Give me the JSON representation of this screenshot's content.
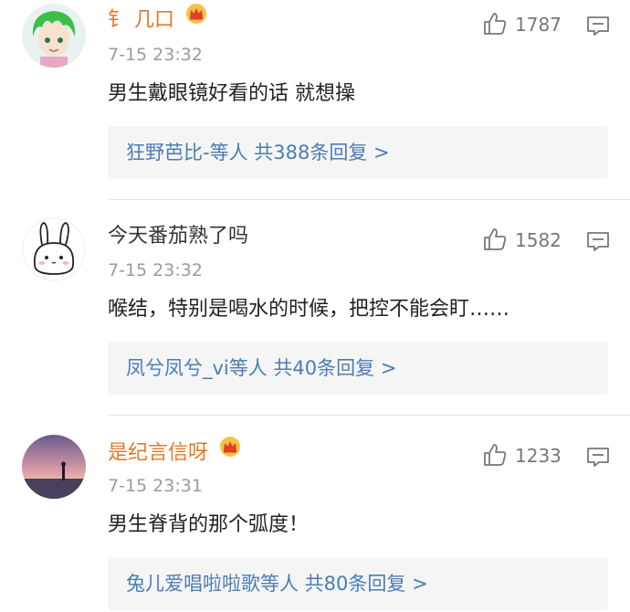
{
  "comments": [
    {
      "username": "钅 几口",
      "time": "7-15 23:32",
      "text": "男生戴眼镜好看的话 就想操",
      "likes": "1787",
      "replies": "狂野芭比-等人 共388条回复 >",
      "vip": true
    },
    {
      "username": "今天番茄熟了吗",
      "time": "7-15 23:32",
      "text": "喉结，特别是喝水的时候，把控不能会盯……",
      "likes": "1582",
      "replies": "凤兮凤兮_vi等人 共40条回复 >",
      "vip": false
    },
    {
      "username": "是纪言信呀",
      "time": "7-15 23:31",
      "text": "男生脊背的那个弧度！",
      "likes": "1233",
      "replies": "兔儿爱唱啦啦歌等人 共80条回复 >",
      "vip": true
    }
  ],
  "colors": {
    "vip_name": "#e07a2a",
    "link": "#4a7db5",
    "reply_bg": "#f5f5f5"
  }
}
